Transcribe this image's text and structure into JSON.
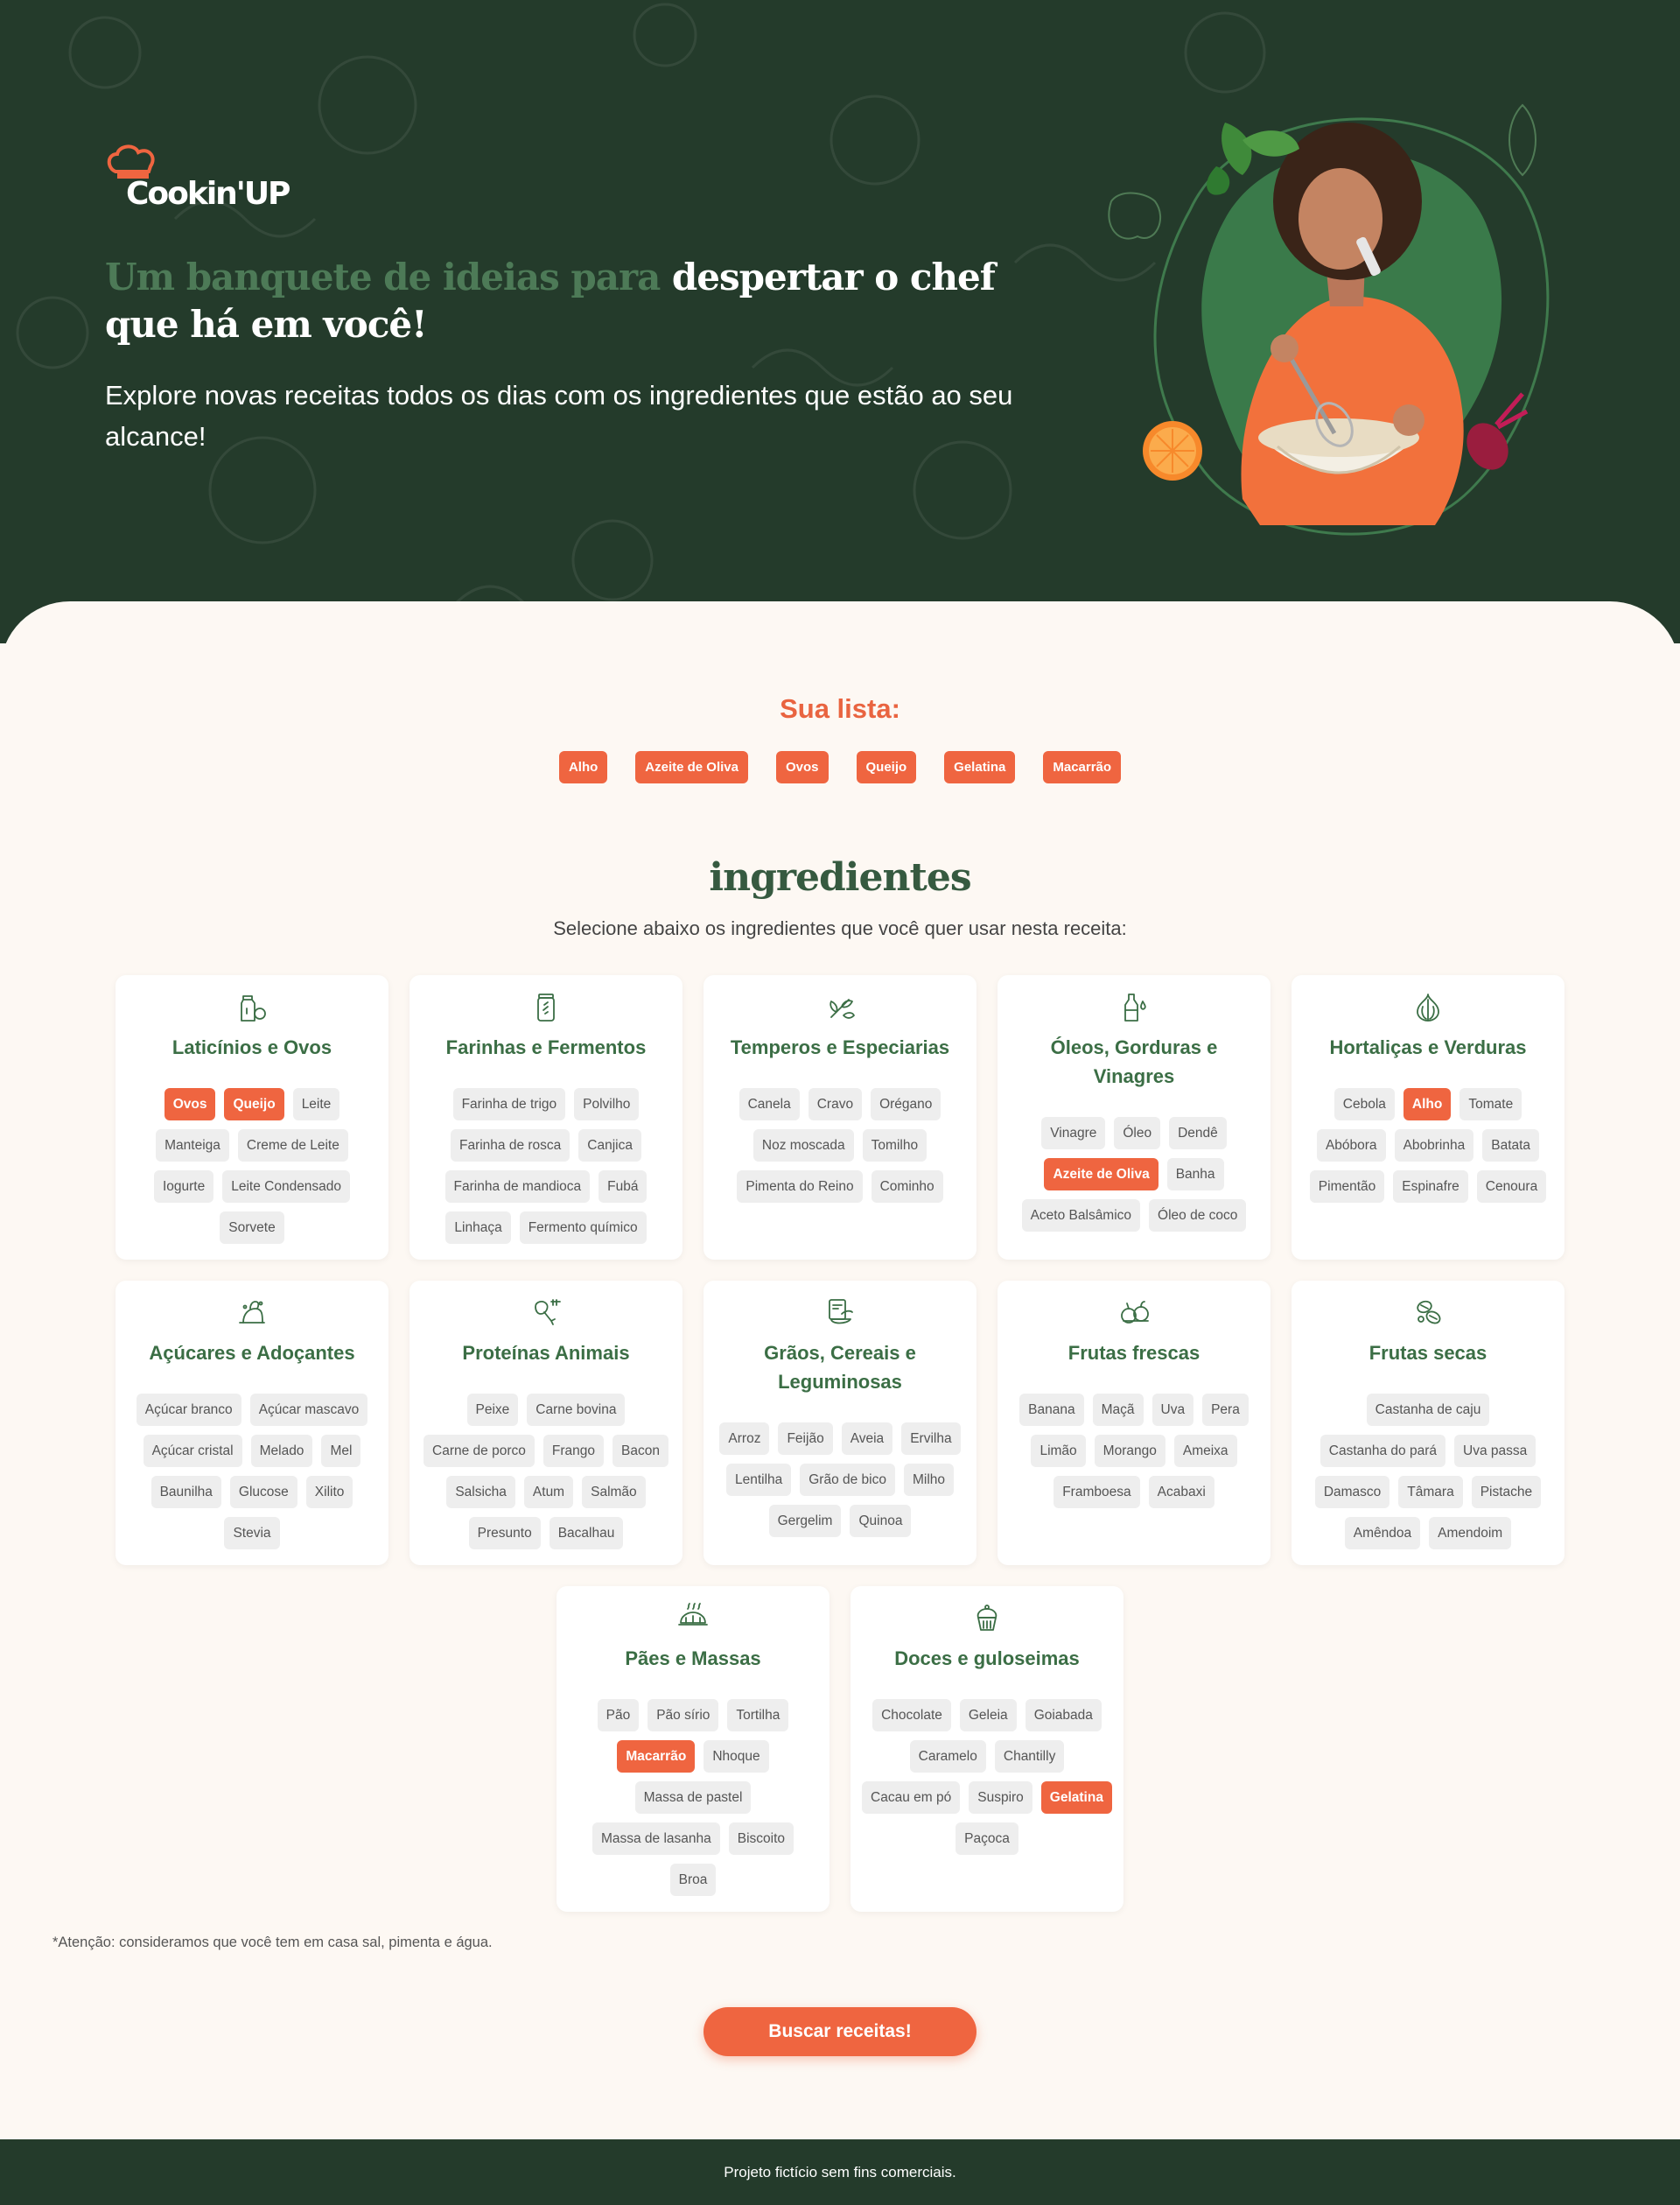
{
  "brand": {
    "logo_text": "Cookin'UP"
  },
  "hero": {
    "headline_accent": "Um banquete de ideias para",
    "headline_rest": " despertar o chef que há em você!",
    "subline": "Explore novas receitas todos os dias com os ingredientes que estão ao seu alcance!"
  },
  "list": {
    "title": "Sua lista:",
    "items": [
      "Alho",
      "Azeite de Oliva",
      "Ovos",
      "Queijo",
      "Gelatina",
      "Macarrão"
    ]
  },
  "ingredients": {
    "title": "ingredientes",
    "subtitle": "Selecione abaixo os ingredientes que você quer usar nesta receita:",
    "categories": [
      {
        "name": "Laticínios e Ovos",
        "icon": "milk-carton-icon",
        "items": [
          {
            "label": "Ovos",
            "selected": true
          },
          {
            "label": "Queijo",
            "selected": true
          },
          {
            "label": "Leite",
            "selected": false
          },
          {
            "label": "Manteiga",
            "selected": false
          },
          {
            "label": "Creme de Leite",
            "selected": false
          },
          {
            "label": "Iogurte",
            "selected": false
          },
          {
            "label": "Leite Condensado",
            "selected": false
          },
          {
            "label": "Sorvete",
            "selected": false
          }
        ]
      },
      {
        "name": "Farinhas e Fermentos",
        "icon": "flour-jar-icon",
        "items": [
          {
            "label": "Farinha de trigo",
            "selected": false
          },
          {
            "label": "Polvilho",
            "selected": false
          },
          {
            "label": "Farinha de rosca",
            "selected": false
          },
          {
            "label": "Canjica",
            "selected": false
          },
          {
            "label": "Farinha de mandioca",
            "selected": false
          },
          {
            "label": "Fubá",
            "selected": false
          },
          {
            "label": "Linhaça",
            "selected": false
          },
          {
            "label": "Fermento químico",
            "selected": false
          }
        ]
      },
      {
        "name": "Temperos e Especiarias",
        "icon": "herbs-icon",
        "items": [
          {
            "label": "Canela",
            "selected": false
          },
          {
            "label": "Cravo",
            "selected": false
          },
          {
            "label": "Orégano",
            "selected": false
          },
          {
            "label": "Noz moscada",
            "selected": false
          },
          {
            "label": "Tomilho",
            "selected": false
          },
          {
            "label": "Pimenta do Reino",
            "selected": false
          },
          {
            "label": "Cominho",
            "selected": false
          }
        ]
      },
      {
        "name": "Óleos, Gorduras e Vinagres",
        "icon": "oil-bottle-icon",
        "items": [
          {
            "label": "Vinagre",
            "selected": false
          },
          {
            "label": "Óleo",
            "selected": false
          },
          {
            "label": "Dendê",
            "selected": false
          },
          {
            "label": "Azeite de Oliva",
            "selected": true
          },
          {
            "label": "Banha",
            "selected": false
          },
          {
            "label": "Aceto Balsâmico",
            "selected": false
          },
          {
            "label": "Óleo de coco",
            "selected": false
          }
        ]
      },
      {
        "name": "Hortaliças e Verduras",
        "icon": "garlic-icon",
        "items": [
          {
            "label": "Cebola",
            "selected": false
          },
          {
            "label": "Alho",
            "selected": true
          },
          {
            "label": "Tomate",
            "selected": false
          },
          {
            "label": "Abóbora",
            "selected": false
          },
          {
            "label": "Abobrinha",
            "selected": false
          },
          {
            "label": "Batata",
            "selected": false
          },
          {
            "label": "Pimentão",
            "selected": false
          },
          {
            "label": "Espinafre",
            "selected": false
          },
          {
            "label": "Cenoura",
            "selected": false
          }
        ]
      },
      {
        "name": "Açúcares e Adoçantes",
        "icon": "sugar-pile-icon",
        "items": [
          {
            "label": "Açúcar branco",
            "selected": false
          },
          {
            "label": "Açúcar mascavo",
            "selected": false
          },
          {
            "label": "Açúcar cristal",
            "selected": false
          },
          {
            "label": "Melado",
            "selected": false
          },
          {
            "label": "Mel",
            "selected": false
          },
          {
            "label": "Baunilha",
            "selected": false
          },
          {
            "label": "Glucose",
            "selected": false
          },
          {
            "label": "Xilito",
            "selected": false
          },
          {
            "label": "Stevia",
            "selected": false
          }
        ]
      },
      {
        "name": "Proteínas Animais",
        "icon": "meat-icon",
        "items": [
          {
            "label": "Peixe",
            "selected": false
          },
          {
            "label": "Carne bovina",
            "selected": false
          },
          {
            "label": "Carne de porco",
            "selected": false
          },
          {
            "label": "Frango",
            "selected": false
          },
          {
            "label": "Bacon",
            "selected": false
          },
          {
            "label": "Salsicha",
            "selected": false
          },
          {
            "label": "Atum",
            "selected": false
          },
          {
            "label": "Salmão",
            "selected": false
          },
          {
            "label": "Presunto",
            "selected": false
          },
          {
            "label": "Bacalhau",
            "selected": false
          }
        ]
      },
      {
        "name": "Grãos, Cereais e Leguminosas",
        "icon": "grain-bowl-icon",
        "items": [
          {
            "label": "Arroz",
            "selected": false
          },
          {
            "label": "Feijão",
            "selected": false
          },
          {
            "label": "Aveia",
            "selected": false
          },
          {
            "label": "Ervilha",
            "selected": false
          },
          {
            "label": "Lentilha",
            "selected": false
          },
          {
            "label": "Grão de bico",
            "selected": false
          },
          {
            "label": "Milho",
            "selected": false
          },
          {
            "label": "Gergelim",
            "selected": false
          },
          {
            "label": "Quinoa",
            "selected": false
          }
        ]
      },
      {
        "name": "Frutas frescas",
        "icon": "fruits-icon",
        "items": [
          {
            "label": "Banana",
            "selected": false
          },
          {
            "label": "Maçã",
            "selected": false
          },
          {
            "label": "Uva",
            "selected": false
          },
          {
            "label": "Pera",
            "selected": false
          },
          {
            "label": "Limão",
            "selected": false
          },
          {
            "label": "Morango",
            "selected": false
          },
          {
            "label": "Ameixa",
            "selected": false
          },
          {
            "label": "Framboesa",
            "selected": false
          },
          {
            "label": "Acabaxi",
            "selected": false
          }
        ]
      },
      {
        "name": "Frutas secas",
        "icon": "nuts-icon",
        "items": [
          {
            "label": "Castanha de caju",
            "selected": false
          },
          {
            "label": "Castanha do pará",
            "selected": false
          },
          {
            "label": "Uva passa",
            "selected": false
          },
          {
            "label": "Damasco",
            "selected": false
          },
          {
            "label": "Tâmara",
            "selected": false
          },
          {
            "label": "Pistache",
            "selected": false
          },
          {
            "label": "Amêndoa",
            "selected": false
          },
          {
            "label": "Amendoim",
            "selected": false
          }
        ]
      },
      {
        "name": "Pães e Massas",
        "icon": "bread-icon",
        "items": [
          {
            "label": "Pão",
            "selected": false
          },
          {
            "label": "Pão sírio",
            "selected": false
          },
          {
            "label": "Tortilha",
            "selected": false
          },
          {
            "label": "Macarrão",
            "selected": true
          },
          {
            "label": "Nhoque",
            "selected": false
          },
          {
            "label": "Massa de pastel",
            "selected": false
          },
          {
            "label": "Massa de lasanha",
            "selected": false
          },
          {
            "label": "Biscoito",
            "selected": false
          },
          {
            "label": "Broa",
            "selected": false
          }
        ]
      },
      {
        "name": "Doces e guloseimas",
        "icon": "cupcake-icon",
        "items": [
          {
            "label": "Chocolate",
            "selected": false
          },
          {
            "label": "Geleia",
            "selected": false
          },
          {
            "label": "Goiabada",
            "selected": false
          },
          {
            "label": "Caramelo",
            "selected": false
          },
          {
            "label": "Chantilly",
            "selected": false
          },
          {
            "label": "Cacau em pó",
            "selected": false
          },
          {
            "label": "Suspiro",
            "selected": false
          },
          {
            "label": "Gelatina",
            "selected": true
          },
          {
            "label": "Paçoca",
            "selected": false
          }
        ]
      }
    ],
    "note": "*Atenção: consideramos que você tem em casa sal, pimenta e água.",
    "search_button": "Buscar receitas!"
  },
  "footer": {
    "text": "Projeto fictício sem fins comerciais."
  },
  "colors": {
    "hero_bg": "#243b2b",
    "accent_orange": "#ef6540",
    "accent_green": "#3b6e45",
    "page_bg": "#fdf8f3",
    "chip_bg": "#eeeeee"
  }
}
